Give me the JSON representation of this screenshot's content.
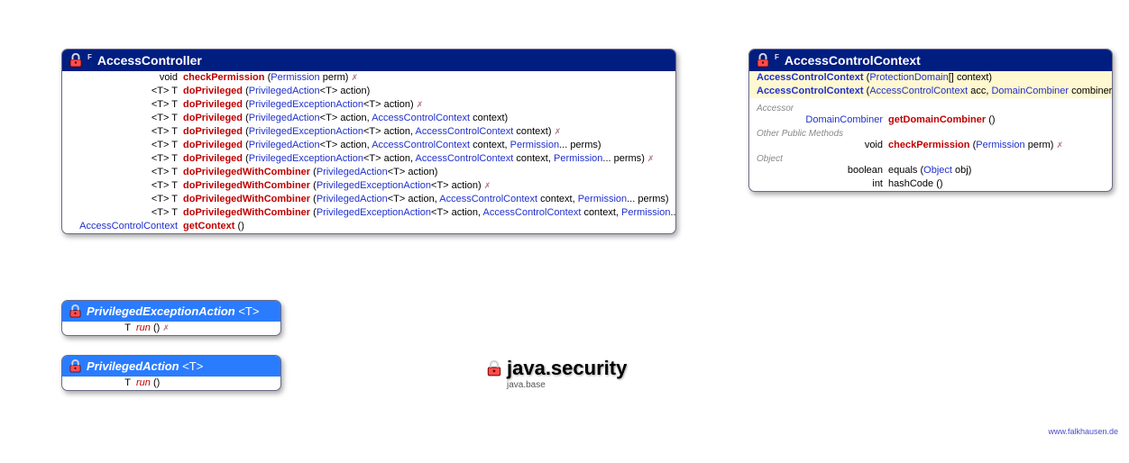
{
  "package": {
    "name": "java.security",
    "module": "java.base"
  },
  "credit": "www.falkhausen.de",
  "accessController": {
    "title": "AccessController",
    "sup": "F",
    "rows": [
      {
        "lhs": "void",
        "m": "checkPermission",
        "sig": "(Permission perm)",
        "exc": true,
        "mi": false
      },
      {
        "lhs": "<T> T",
        "m": "doPrivileged",
        "sig": "(PrivilegedAction<T> action)",
        "exc": false
      },
      {
        "lhs": "<T> T",
        "m": "doPrivileged",
        "sig": "(PrivilegedExceptionAction<T> action)",
        "exc": true
      },
      {
        "lhs": "<T> T",
        "m": "doPrivileged",
        "sig": "(PrivilegedAction<T> action, AccessControlContext context)",
        "exc": false
      },
      {
        "lhs": "<T> T",
        "m": "doPrivileged",
        "sig": "(PrivilegedExceptionAction<T> action, AccessControlContext context)",
        "exc": true
      },
      {
        "lhs": "<T> T",
        "m": "doPrivileged",
        "sig": "(PrivilegedAction<T> action, AccessControlContext context, Permission... perms)",
        "exc": false
      },
      {
        "lhs": "<T> T",
        "m": "doPrivileged",
        "sig": "(PrivilegedExceptionAction<T> action, AccessControlContext context, Permission... perms)",
        "exc": true
      },
      {
        "lhs": "<T> T",
        "m": "doPrivilegedWithCombiner",
        "sig": "(PrivilegedAction<T> action)",
        "exc": false
      },
      {
        "lhs": "<T> T",
        "m": "doPrivilegedWithCombiner",
        "sig": "(PrivilegedExceptionAction<T> action)",
        "exc": true
      },
      {
        "lhs": "<T> T",
        "m": "doPrivilegedWithCombiner",
        "sig": "(PrivilegedAction<T> action, AccessControlContext context, Permission... perms)",
        "exc": false
      },
      {
        "lhs": "<T> T",
        "m": "doPrivilegedWithCombiner",
        "sig": "(PrivilegedExceptionAction<T> action, AccessControlContext context, Permission... perms)",
        "exc": true
      },
      {
        "lhs": "AccessControlContext",
        "m": "getContext",
        "sig": "()",
        "exc": false,
        "lhsType": true
      }
    ]
  },
  "accessControlContext": {
    "title": "AccessControlContext",
    "sup": "F",
    "ctors": [
      {
        "m": "AccessControlContext",
        "sig": "(ProtectionDomain[] context)"
      },
      {
        "m": "AccessControlContext",
        "sig": "(AccessControlContext acc, DomainCombiner combiner)"
      }
    ],
    "accessor": [
      {
        "lhs": "DomainCombiner",
        "m": "getDomainCombiner",
        "sig": "()",
        "lhsType": true
      }
    ],
    "otherPublic": [
      {
        "lhs": "void",
        "m": "checkPermission",
        "sig": "(Permission perm)",
        "exc": true
      }
    ],
    "object": [
      {
        "lhs": "boolean",
        "m": "equals",
        "sig": "(Object obj)",
        "plain": true
      },
      {
        "lhs": "int",
        "m": "hashCode",
        "sig": "()",
        "plain": true
      }
    ],
    "sections": {
      "accessor": "Accessor",
      "other": "Other Public Methods",
      "object": "Object"
    }
  },
  "pea": {
    "title": "PrivilegedExceptionAction",
    "tp": "<T>",
    "row": {
      "lhs": "T",
      "m": "run",
      "sig": "()",
      "exc": true
    }
  },
  "pa": {
    "title": "PrivilegedAction",
    "tp": "<T>",
    "row": {
      "lhs": "T",
      "m": "run",
      "sig": "()"
    }
  }
}
